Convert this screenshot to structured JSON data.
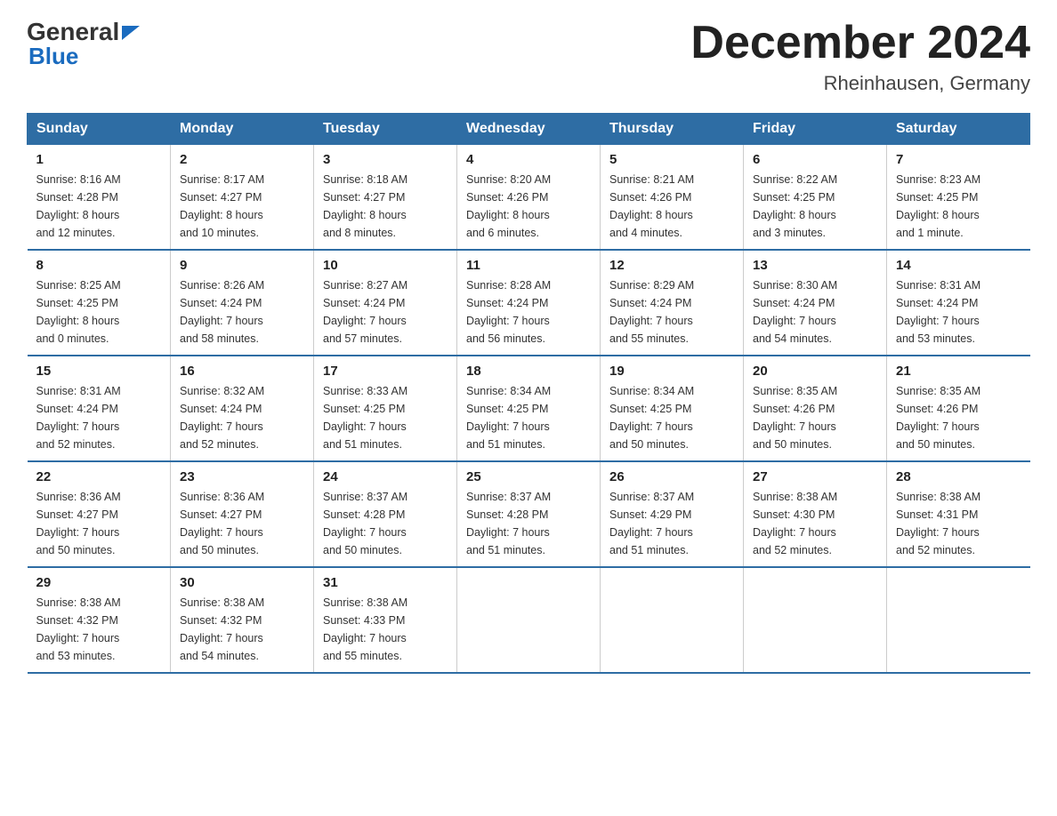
{
  "header": {
    "logo_text_general": "General",
    "logo_text_blue": "Blue",
    "month_title": "December 2024",
    "location": "Rheinhausen, Germany"
  },
  "calendar": {
    "days_of_week": [
      "Sunday",
      "Monday",
      "Tuesday",
      "Wednesday",
      "Thursday",
      "Friday",
      "Saturday"
    ],
    "weeks": [
      [
        {
          "day": "1",
          "sunrise": "Sunrise: 8:16 AM",
          "sunset": "Sunset: 4:28 PM",
          "daylight": "Daylight: 8 hours",
          "daylight2": "and 12 minutes."
        },
        {
          "day": "2",
          "sunrise": "Sunrise: 8:17 AM",
          "sunset": "Sunset: 4:27 PM",
          "daylight": "Daylight: 8 hours",
          "daylight2": "and 10 minutes."
        },
        {
          "day": "3",
          "sunrise": "Sunrise: 8:18 AM",
          "sunset": "Sunset: 4:27 PM",
          "daylight": "Daylight: 8 hours",
          "daylight2": "and 8 minutes."
        },
        {
          "day": "4",
          "sunrise": "Sunrise: 8:20 AM",
          "sunset": "Sunset: 4:26 PM",
          "daylight": "Daylight: 8 hours",
          "daylight2": "and 6 minutes."
        },
        {
          "day": "5",
          "sunrise": "Sunrise: 8:21 AM",
          "sunset": "Sunset: 4:26 PM",
          "daylight": "Daylight: 8 hours",
          "daylight2": "and 4 minutes."
        },
        {
          "day": "6",
          "sunrise": "Sunrise: 8:22 AM",
          "sunset": "Sunset: 4:25 PM",
          "daylight": "Daylight: 8 hours",
          "daylight2": "and 3 minutes."
        },
        {
          "day": "7",
          "sunrise": "Sunrise: 8:23 AM",
          "sunset": "Sunset: 4:25 PM",
          "daylight": "Daylight: 8 hours",
          "daylight2": "and 1 minute."
        }
      ],
      [
        {
          "day": "8",
          "sunrise": "Sunrise: 8:25 AM",
          "sunset": "Sunset: 4:25 PM",
          "daylight": "Daylight: 8 hours",
          "daylight2": "and 0 minutes."
        },
        {
          "day": "9",
          "sunrise": "Sunrise: 8:26 AM",
          "sunset": "Sunset: 4:24 PM",
          "daylight": "Daylight: 7 hours",
          "daylight2": "and 58 minutes."
        },
        {
          "day": "10",
          "sunrise": "Sunrise: 8:27 AM",
          "sunset": "Sunset: 4:24 PM",
          "daylight": "Daylight: 7 hours",
          "daylight2": "and 57 minutes."
        },
        {
          "day": "11",
          "sunrise": "Sunrise: 8:28 AM",
          "sunset": "Sunset: 4:24 PM",
          "daylight": "Daylight: 7 hours",
          "daylight2": "and 56 minutes."
        },
        {
          "day": "12",
          "sunrise": "Sunrise: 8:29 AM",
          "sunset": "Sunset: 4:24 PM",
          "daylight": "Daylight: 7 hours",
          "daylight2": "and 55 minutes."
        },
        {
          "day": "13",
          "sunrise": "Sunrise: 8:30 AM",
          "sunset": "Sunset: 4:24 PM",
          "daylight": "Daylight: 7 hours",
          "daylight2": "and 54 minutes."
        },
        {
          "day": "14",
          "sunrise": "Sunrise: 8:31 AM",
          "sunset": "Sunset: 4:24 PM",
          "daylight": "Daylight: 7 hours",
          "daylight2": "and 53 minutes."
        }
      ],
      [
        {
          "day": "15",
          "sunrise": "Sunrise: 8:31 AM",
          "sunset": "Sunset: 4:24 PM",
          "daylight": "Daylight: 7 hours",
          "daylight2": "and 52 minutes."
        },
        {
          "day": "16",
          "sunrise": "Sunrise: 8:32 AM",
          "sunset": "Sunset: 4:24 PM",
          "daylight": "Daylight: 7 hours",
          "daylight2": "and 52 minutes."
        },
        {
          "day": "17",
          "sunrise": "Sunrise: 8:33 AM",
          "sunset": "Sunset: 4:25 PM",
          "daylight": "Daylight: 7 hours",
          "daylight2": "and 51 minutes."
        },
        {
          "day": "18",
          "sunrise": "Sunrise: 8:34 AM",
          "sunset": "Sunset: 4:25 PM",
          "daylight": "Daylight: 7 hours",
          "daylight2": "and 51 minutes."
        },
        {
          "day": "19",
          "sunrise": "Sunrise: 8:34 AM",
          "sunset": "Sunset: 4:25 PM",
          "daylight": "Daylight: 7 hours",
          "daylight2": "and 50 minutes."
        },
        {
          "day": "20",
          "sunrise": "Sunrise: 8:35 AM",
          "sunset": "Sunset: 4:26 PM",
          "daylight": "Daylight: 7 hours",
          "daylight2": "and 50 minutes."
        },
        {
          "day": "21",
          "sunrise": "Sunrise: 8:35 AM",
          "sunset": "Sunset: 4:26 PM",
          "daylight": "Daylight: 7 hours",
          "daylight2": "and 50 minutes."
        }
      ],
      [
        {
          "day": "22",
          "sunrise": "Sunrise: 8:36 AM",
          "sunset": "Sunset: 4:27 PM",
          "daylight": "Daylight: 7 hours",
          "daylight2": "and 50 minutes."
        },
        {
          "day": "23",
          "sunrise": "Sunrise: 8:36 AM",
          "sunset": "Sunset: 4:27 PM",
          "daylight": "Daylight: 7 hours",
          "daylight2": "and 50 minutes."
        },
        {
          "day": "24",
          "sunrise": "Sunrise: 8:37 AM",
          "sunset": "Sunset: 4:28 PM",
          "daylight": "Daylight: 7 hours",
          "daylight2": "and 50 minutes."
        },
        {
          "day": "25",
          "sunrise": "Sunrise: 8:37 AM",
          "sunset": "Sunset: 4:28 PM",
          "daylight": "Daylight: 7 hours",
          "daylight2": "and 51 minutes."
        },
        {
          "day": "26",
          "sunrise": "Sunrise: 8:37 AM",
          "sunset": "Sunset: 4:29 PM",
          "daylight": "Daylight: 7 hours",
          "daylight2": "and 51 minutes."
        },
        {
          "day": "27",
          "sunrise": "Sunrise: 8:38 AM",
          "sunset": "Sunset: 4:30 PM",
          "daylight": "Daylight: 7 hours",
          "daylight2": "and 52 minutes."
        },
        {
          "day": "28",
          "sunrise": "Sunrise: 8:38 AM",
          "sunset": "Sunset: 4:31 PM",
          "daylight": "Daylight: 7 hours",
          "daylight2": "and 52 minutes."
        }
      ],
      [
        {
          "day": "29",
          "sunrise": "Sunrise: 8:38 AM",
          "sunset": "Sunset: 4:32 PM",
          "daylight": "Daylight: 7 hours",
          "daylight2": "and 53 minutes."
        },
        {
          "day": "30",
          "sunrise": "Sunrise: 8:38 AM",
          "sunset": "Sunset: 4:32 PM",
          "daylight": "Daylight: 7 hours",
          "daylight2": "and 54 minutes."
        },
        {
          "day": "31",
          "sunrise": "Sunrise: 8:38 AM",
          "sunset": "Sunset: 4:33 PM",
          "daylight": "Daylight: 7 hours",
          "daylight2": "and 55 minutes."
        },
        null,
        null,
        null,
        null
      ]
    ]
  }
}
